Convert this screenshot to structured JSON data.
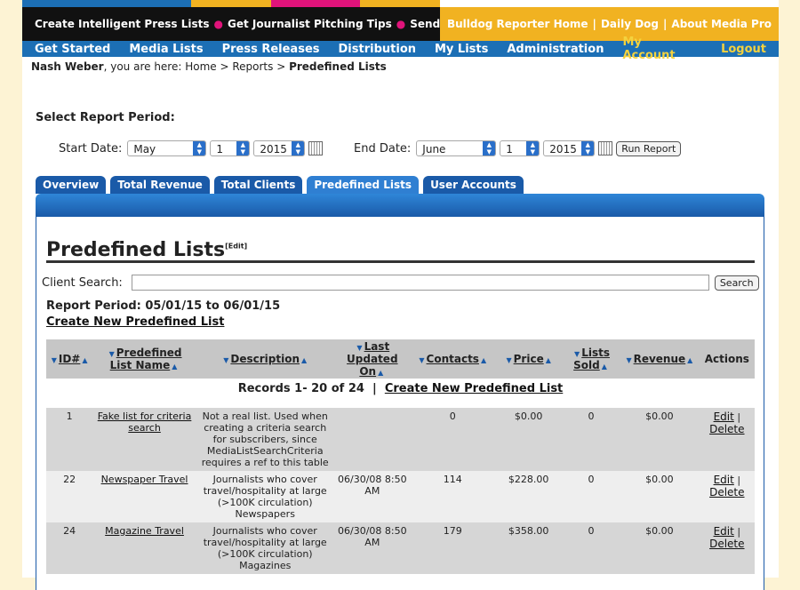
{
  "topbar": {
    "left_links": [
      "Create Intelligent Press Lists",
      "Get Journalist Pitching Tips",
      "Send Releases"
    ],
    "right_links": [
      "Bulldog Reporter Home",
      "Daily Dog",
      "About Media Pro"
    ],
    "colors": [
      "#1c6fb5",
      "#f1b221",
      "#e0137a",
      "#f1b221",
      "#ffffff"
    ]
  },
  "nav": {
    "items": [
      "Get Started",
      "Media Lists",
      "Press Releases",
      "Distribution",
      "My Lists",
      "Administration"
    ],
    "my_account": "My Account",
    "logout": "Logout"
  },
  "breadcrumb": {
    "user": "Nash Weber",
    "text": ", you are here: Home > Reports > ",
    "current": "Predefined Lists"
  },
  "period": {
    "label": "Select Report Period:",
    "start_label": "Start Date:",
    "start_month": "May",
    "start_day": "1",
    "start_year": "2015",
    "end_label": "End Date:",
    "end_month": "June",
    "end_day": "1",
    "end_year": "2015",
    "run_button": "Run Report"
  },
  "tabs": [
    "Overview",
    "Total Revenue",
    "Total Clients",
    "Predefined Lists",
    "User Accounts"
  ],
  "active_tab": "Predefined Lists",
  "page": {
    "title": "Predefined Lists",
    "edit": "[Edit]",
    "client_search_label": "Client Search:",
    "search_button": "Search",
    "report_period": "Report Period: 05/01/15 to 06/01/15",
    "create_new": "Create New Predefined List",
    "records_text": "Records 1- 20 of 24",
    "records_sep": "|",
    "records_create": "Create New Predefined List"
  },
  "table": {
    "headers": [
      "ID#",
      "Predefined List Name",
      "Description",
      "Last Updated On",
      "Contacts",
      "Price",
      "Lists Sold",
      "Revenue",
      "Actions"
    ],
    "rows": [
      {
        "id": "1",
        "name": "Fake list for criteria search",
        "description": "Not a real list. Used when creating a criteria search for subscribers, since MediaListSearchCriteria requires a ref to this table",
        "updated": "",
        "contacts": "0",
        "price": "$0.00",
        "sold": "0",
        "revenue": "$0.00",
        "edit": "Edit",
        "delete": "Delete"
      },
      {
        "id": "22",
        "name": "Newspaper Travel",
        "description": "Journalists who cover travel/hospitality at large (>100K circulation) Newspapers",
        "updated": "06/30/08 8:50 AM",
        "contacts": "114",
        "price": "$228.00",
        "sold": "0",
        "revenue": "$0.00",
        "edit": "Edit",
        "delete": "Delete"
      },
      {
        "id": "24",
        "name": "Magazine Travel",
        "description": "Journalists who cover travel/hospitality at large (>100K circulation) Magazines",
        "updated": "06/30/08 8:50 AM",
        "contacts": "179",
        "price": "$358.00",
        "sold": "0",
        "revenue": "$0.00",
        "edit": "Edit",
        "delete": "Delete"
      }
    ]
  }
}
